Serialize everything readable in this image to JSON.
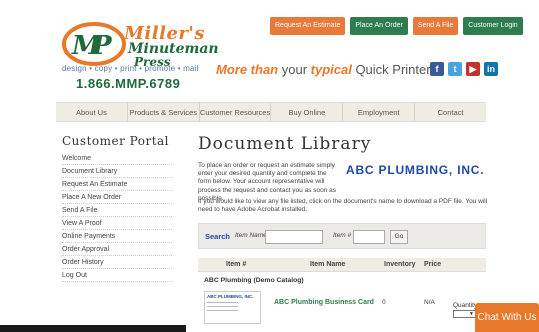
{
  "header": {
    "logo_line1": "Miller's",
    "logo_line2": "Minuteman",
    "logo_line3": "Press",
    "tagline": "design • copy • print • promote • mail",
    "phone": "1.866.MMP.6789",
    "top_buttons": [
      "Request An Estimate",
      "Place An Order",
      "Send A File",
      "Customer Login"
    ],
    "slogan_part1": "More than",
    "slogan_part2": " your ",
    "slogan_part3": "typical",
    "slogan_part4": " Quick Printer.",
    "social_icons": [
      "facebook-icon",
      "twitter-icon",
      "youtube-icon",
      "linkedin-icon"
    ]
  },
  "nav": [
    "About Us",
    "Products & Services",
    "Customer Resources",
    "Buy Online",
    "Employment",
    "Contact"
  ],
  "sidebar": {
    "title": "Customer Portal",
    "items": [
      "Welcome",
      "Document Library",
      "Request An Estimate",
      "Place A New Order",
      "Send A File",
      "View A Proof",
      "Online Payments",
      "Order Approval",
      "Order History",
      "Log Out"
    ]
  },
  "main": {
    "title": "Document Library",
    "intro": "To place an order or request an estimate simply enter your desired quantity and complete the form below. Your account representative will process the request and contact you as soon as possible.",
    "company": "ABC PLUMBING, INC.",
    "pdf_note": "If you would like to view any file listed, click on the document's name to download a PDF file. You will need to have Adobe Acrobat installed.",
    "search": {
      "label": "Search",
      "item_name_label": "Item Name",
      "item_num_label": "Item #",
      "go": "Go"
    },
    "table": {
      "headers": [
        "Item #",
        "Item Name",
        "Inventory",
        "Price"
      ],
      "group": "ABC Plumbing (Demo Catalog)",
      "rows": [
        {
          "thumb_title": "ABC PLUMBING, INC.",
          "name": "ABC Plumbing Business Card",
          "inventory": "0",
          "price": "N/A",
          "qty_label": "Quantity"
        }
      ]
    }
  },
  "chat": "Chat With Us",
  "colors": {
    "orange": "#e8782a",
    "green": "#2e7d4e",
    "blue": "#1e4aa3"
  }
}
